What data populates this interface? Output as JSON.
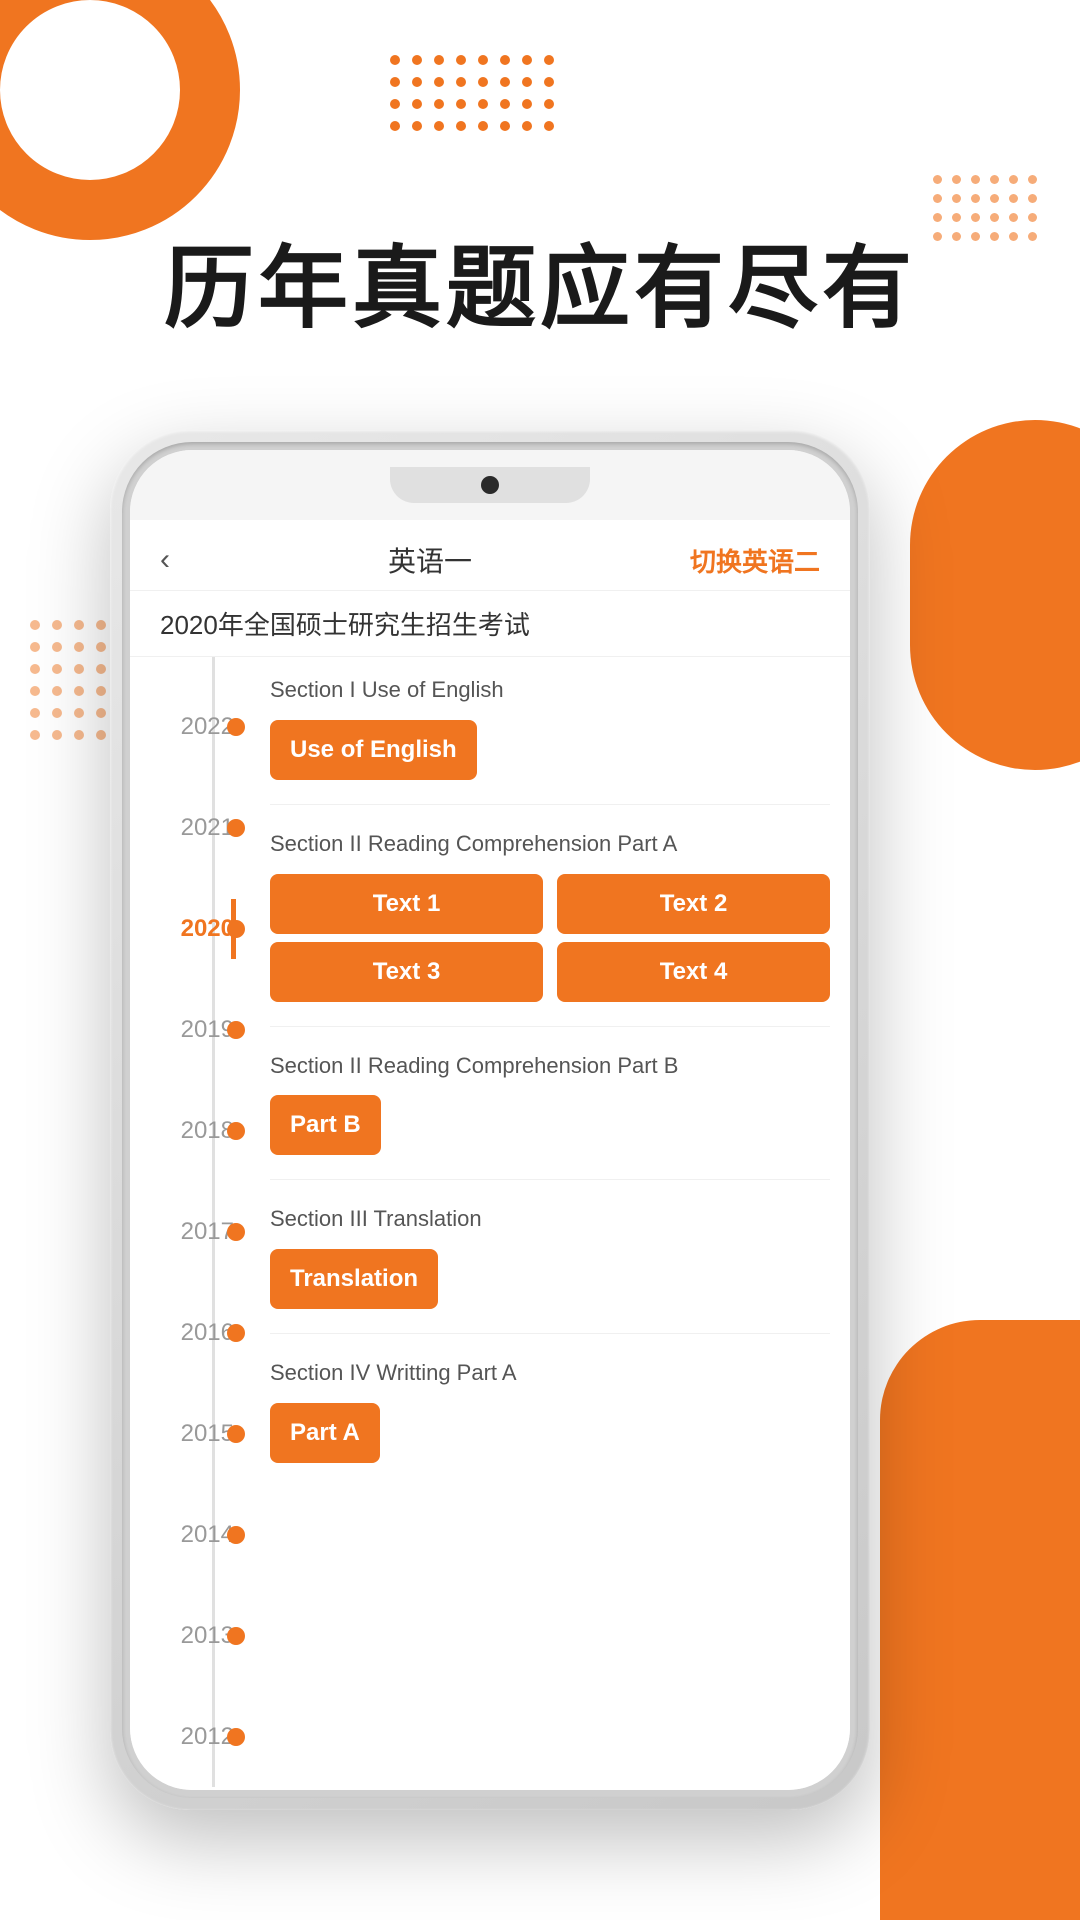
{
  "decorative": {
    "dots_top_count": 32,
    "dots_right_count": 24,
    "dots_left_count": 30
  },
  "headline": "历年真题应有尽有",
  "phone": {
    "notch": "speaker-notch",
    "header": {
      "back_label": "‹",
      "title": "英语一",
      "switch_label": "切换英语二"
    },
    "subtitle": "2020年全国硕士研究生招生考试",
    "timeline": {
      "years": [
        {
          "year": "2022",
          "active": false
        },
        {
          "year": "2021",
          "active": false
        },
        {
          "year": "2020",
          "active": true
        },
        {
          "year": "2019",
          "active": false
        },
        {
          "year": "2018",
          "active": false
        },
        {
          "year": "2017",
          "active": false
        },
        {
          "year": "2016",
          "active": false
        },
        {
          "year": "2015",
          "active": false
        },
        {
          "year": "2014",
          "active": false
        },
        {
          "year": "2013",
          "active": false
        },
        {
          "year": "2012",
          "active": false
        }
      ]
    },
    "sections": [
      {
        "id": "section1",
        "label": "Section I Use of English",
        "buttons": [
          {
            "label": "Use of English",
            "wide": true
          }
        ]
      },
      {
        "id": "section2a",
        "label": "Section II Reading Comprehension Part A",
        "buttons": [
          {
            "label": "Text 1"
          },
          {
            "label": "Text 2"
          },
          {
            "label": "Text 3"
          },
          {
            "label": "Text 4"
          }
        ]
      },
      {
        "id": "section2b",
        "label": "Section II Reading Comprehension Part B",
        "buttons": [
          {
            "label": "Part B",
            "wide": true
          }
        ]
      },
      {
        "id": "section3",
        "label": "Section III Translation",
        "buttons": [
          {
            "label": "Translation",
            "wide": true
          }
        ]
      },
      {
        "id": "section4",
        "label": "Section IV Writting Part A",
        "buttons": [
          {
            "label": "Part A",
            "wide": true
          }
        ]
      }
    ]
  },
  "colors": {
    "orange": "#F07520",
    "text_dark": "#1a1a1a",
    "text_mid": "#555555",
    "text_light": "#999999"
  }
}
